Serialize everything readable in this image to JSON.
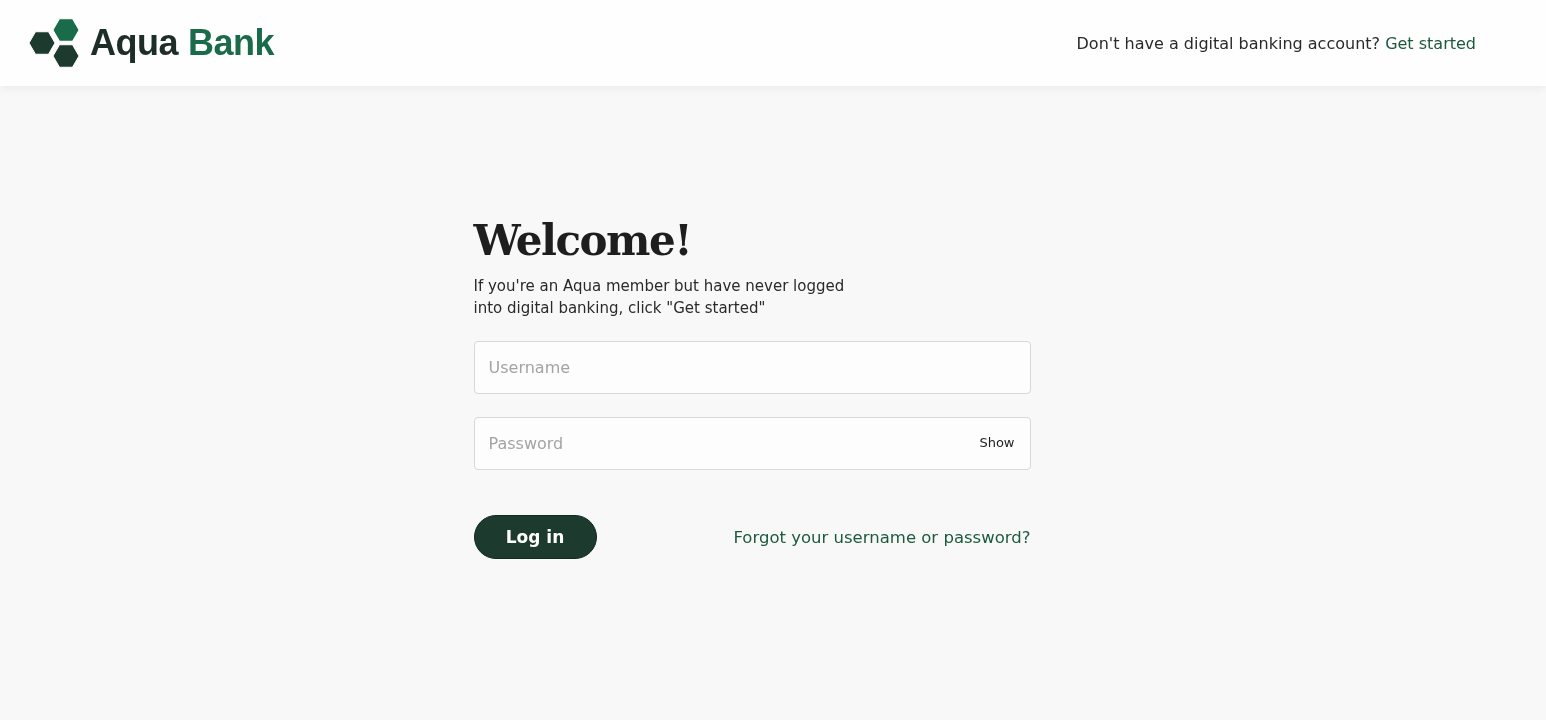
{
  "header": {
    "brand": {
      "first": "Aqua",
      "second": "Bank"
    },
    "prompt": "Don't have a digital banking account?",
    "prompt_link": "Get started"
  },
  "login": {
    "title": "Welcome!",
    "intro": "If you're an Aqua member but have never logged into digital banking, click \"Get started\"",
    "fields": [
      {
        "placeholder": "Username"
      },
      {
        "placeholder": "Password",
        "toggle": "Show"
      }
    ],
    "submit": "Log in",
    "forgot_link": "Forgot your username or password?"
  }
}
